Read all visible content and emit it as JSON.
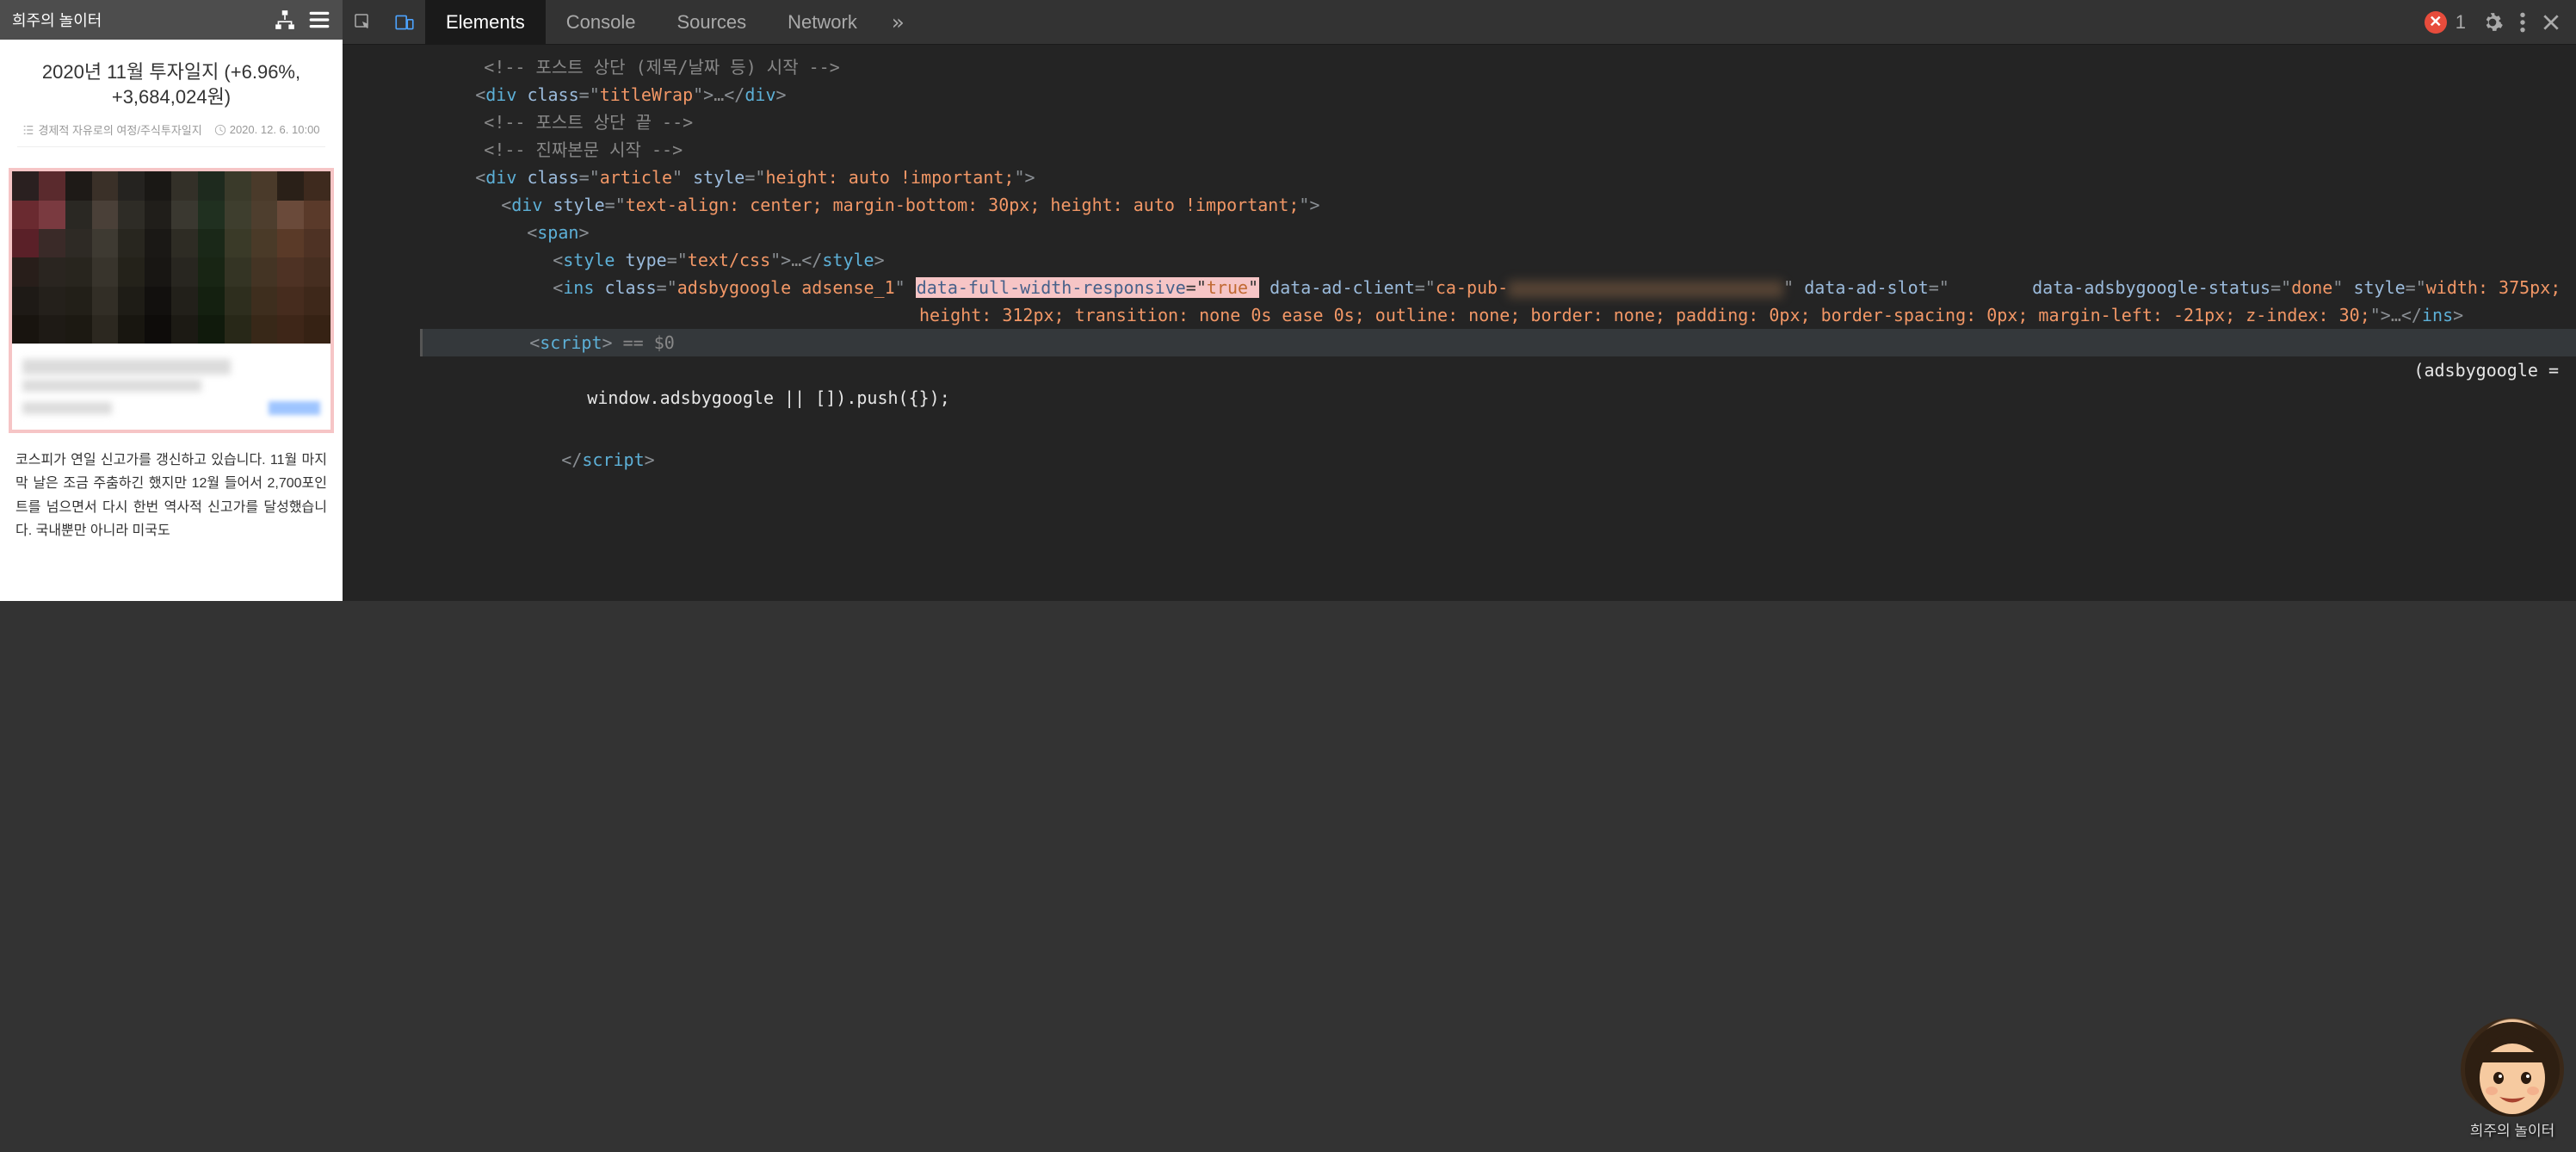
{
  "mobile": {
    "site_title": "희주의 놀이터",
    "article_title": "2020년 11월 투자일지 (+6.96%, +3,684,024원)",
    "category": "경제적 자유로의 여정/주식투자일지",
    "date": "2020. 12. 6. 10:00",
    "body_text": "코스피가 연일 신고가를 갱신하고 있습니다. 11월 마지막 날은 조금 주춤하긴 했지만 12월 들어서 2,700포인트를 넘으면서 다시 한번 역사적 신고가를 달성했습니다. 국내뿐만 아니라 미국도"
  },
  "devtools": {
    "tabs": [
      "Elements",
      "Console",
      "Sources",
      "Network"
    ],
    "active_tab": "Elements",
    "error_count": "1",
    "code": {
      "comment1": "<!-- 포스트 상단 (제목/날짜 등) 시작 -->",
      "titlewrap_open": "<div class=\"titleWrap\">",
      "ellipsis": "…",
      "titlewrap_close": "</div>",
      "comment2": "<!-- 포스트 상단 끝 -->",
      "comment3": "<!-- 진짜본문 시작 -->",
      "article_open": "<div class=\"article\" style=\"height: auto !important;\">",
      "inner_div_open": "<div style=\"text-align: center; margin-bottom: 30px; height: auto !important;\">",
      "span_open": "<span>",
      "style_open": "<style type=\"text/css\">",
      "style_close": "</style>",
      "ins_open": "<ins class=\"adsbygoogle adsense_1\"",
      "ins_hl": "data-full-width-responsive=\"true\"",
      "ins_rest": "data-ad-client=\"ca-pub-",
      "ins_rest2": "\" data-ad-slot=\"",
      "ins_rest3": "data-adsbygoogle-status=\"done\" style=\"width: 375px; height: 312px; transition: none 0s ease 0s; outline: none; border: none; padding: 0px; border-spacing: 0px; margin-left: -21px; z-index: 30;\">",
      "ins_close": "</ins>",
      "script_open": "<script>",
      "selected_sig": " == $0",
      "script_line1": "(adsbygoogle =",
      "script_line2": "window.adsbygoogle || []).push({});",
      "script_close_tag": "</script>"
    }
  },
  "avatar_caption": "희주의 놀이터"
}
